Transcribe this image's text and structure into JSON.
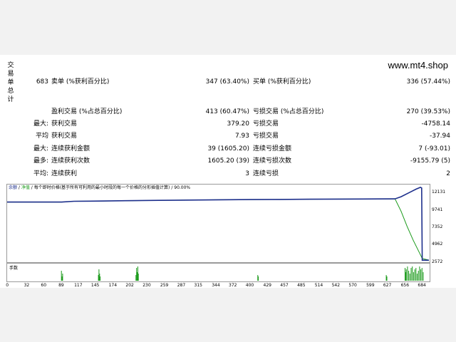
{
  "watermark": "www.mt4.shop",
  "side_title": [
    "交",
    "易",
    "单",
    "总",
    "计"
  ],
  "rows": [
    {
      "c1": "",
      "c2": "683",
      "c3": "卖单 (%获利百分比)",
      "c4": "347 (63.40%)",
      "c5": "买单 (%获利百分比)",
      "c6": "336 (57.44%)"
    },
    {
      "c1": "",
      "c2": "",
      "c3": "盈利交易 (%占总百分比)",
      "c4": "413 (60.47%)",
      "c5": "亏损交易 (%占总百分比)",
      "c6": "270 (39.53%)"
    },
    {
      "c1": "",
      "c2": "最大:",
      "c3": "获利交易",
      "c4": "379.20",
      "c5": "亏损交易",
      "c6": "-4758.14"
    },
    {
      "c1": "",
      "c2": "平均",
      "c3": "获利交易",
      "c4": "7.93",
      "c5": "亏损交易",
      "c6": "-37.94"
    },
    {
      "c1": "",
      "c2": "最大:",
      "c3": "连续获利金额",
      "c4": "39 (1605.20)",
      "c5": "连续亏损金额",
      "c6": "7 (-93.01)"
    },
    {
      "c1": "",
      "c2": "最多:",
      "c3": "连续获利次数",
      "c4": "1605.20 (39)",
      "c5": "连续亏损次数",
      "c6": "-9155.79 (5)"
    },
    {
      "c1": "",
      "c2": "平均:",
      "c3": "连续获利",
      "c4": "3",
      "c5": "连续亏损",
      "c6": "2"
    }
  ],
  "chart_header": {
    "part1": "余额",
    "sep1": " / ",
    "part2": "净值",
    "sep2": " / ",
    "part3": "每个即时价格(基于所有可利用的最小时段的每一个价格的分形插值计算)",
    "sep3": " / ",
    "part4": "90.00%"
  },
  "volume_label": "手数",
  "colors": {
    "balance": "#1d2f8c",
    "equity": "#1a9a1a",
    "volume": "#1a9a1a"
  },
  "chart_data": {
    "type": "line",
    "yticks": [
      12131,
      9741,
      7352,
      4962,
      2572
    ],
    "xticks": [
      0,
      32,
      60,
      89,
      117,
      145,
      174,
      202,
      230,
      259,
      287,
      315,
      344,
      372,
      400,
      429,
      457,
      485,
      514,
      542,
      570,
      599,
      627,
      656,
      684
    ],
    "xlim": [
      0,
      696
    ],
    "ylim": [
      2400,
      12500
    ],
    "series": [
      {
        "name": "余额",
        "x": [
          0,
          90,
          110,
          150,
          195,
          250,
          300,
          350,
          400,
          450,
          500,
          550,
          640,
          650,
          665,
          675,
          682,
          684,
          685,
          696
        ],
        "y": [
          10200,
          10200,
          10300,
          10330,
          10380,
          10420,
          10460,
          10500,
          10530,
          10550,
          10570,
          10590,
          10620,
          10900,
          11500,
          11900,
          12131,
          12050,
          2572,
          2572
        ]
      },
      {
        "name": "净值",
        "x": [
          0,
          90,
          110,
          150,
          195,
          250,
          300,
          350,
          400,
          450,
          500,
          550,
          640,
          650,
          660,
          670,
          680,
          685,
          696
        ],
        "y": [
          10200,
          10200,
          10300,
          10330,
          10380,
          10420,
          10460,
          10500,
          10530,
          10550,
          10570,
          10590,
          10620,
          9000,
          7000,
          5200,
          3600,
          2800,
          2572
        ]
      }
    ],
    "volume": {
      "x": [
        89,
        90,
        91,
        150,
        151,
        152,
        153,
        212,
        213,
        214,
        215,
        216,
        413,
        414,
        625,
        626,
        656,
        657,
        658,
        660,
        662,
        664,
        666,
        668,
        670,
        672,
        674,
        676,
        678,
        680,
        682,
        684,
        686
      ],
      "v": [
        0.7,
        0.3,
        0.5,
        0.4,
        0.8,
        0.5,
        0.3,
        0.4,
        0.9,
        0.6,
        1.0,
        0.5,
        0.4,
        0.3,
        0.4,
        0.3,
        0.9,
        0.6,
        0.8,
        1.0,
        0.7,
        0.5,
        0.9,
        1.0,
        0.6,
        0.8,
        0.9,
        0.5,
        0.7,
        1.0,
        0.8,
        0.9,
        0.6
      ]
    }
  }
}
